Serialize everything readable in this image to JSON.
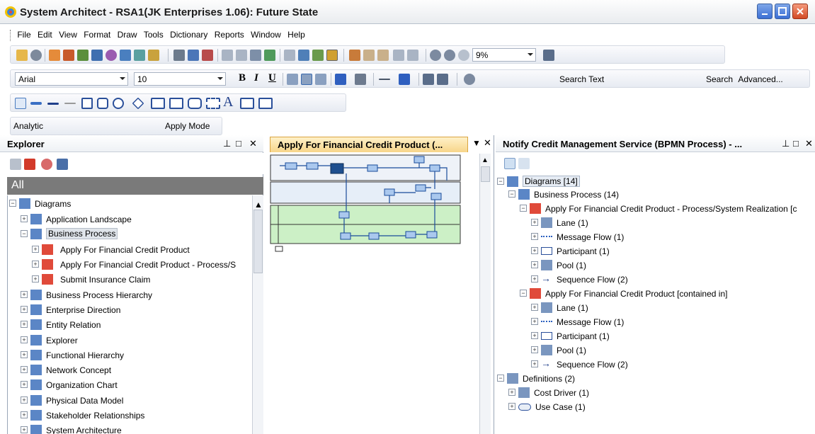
{
  "window": {
    "title": "System Architect - RSA1(JK Enterprises 1.06): Future State"
  },
  "menu": [
    "File",
    "Edit",
    "View",
    "Format",
    "Draw",
    "Tools",
    "Dictionary",
    "Reports",
    "Window",
    "Help"
  ],
  "toolbar": {
    "zoom": "9%",
    "font": "Arial",
    "font_size": "10",
    "search_text": "Search Text",
    "search_label": "Search",
    "advanced_label": "Advanced...",
    "mode": "Analytic",
    "apply_mode": "Apply Mode"
  },
  "explorer": {
    "title": "Explorer",
    "filter": "All",
    "items": [
      {
        "label": "Diagrams"
      },
      {
        "label": "Application Landscape"
      },
      {
        "label": "Business Process"
      },
      {
        "label": "Apply For Financial Credit Product"
      },
      {
        "label": "Apply For Financial Credit Product - Process/S"
      },
      {
        "label": "Submit Insurance Claim"
      },
      {
        "label": "Business Process Hierarchy"
      },
      {
        "label": "Enterprise Direction"
      },
      {
        "label": "Entity Relation"
      },
      {
        "label": "Explorer"
      },
      {
        "label": "Functional Hierarchy"
      },
      {
        "label": "Network Concept"
      },
      {
        "label": "Organization Chart"
      },
      {
        "label": "Physical Data Model"
      },
      {
        "label": "Stakeholder Relationships"
      },
      {
        "label": "System Architecture"
      }
    ]
  },
  "diagram": {
    "tab_title": "Apply For Financial Credit Product (..."
  },
  "details": {
    "title": "Notify Credit Management Service (BPMN Process) - ...",
    "items": [
      {
        "label": "Diagrams [14]"
      },
      {
        "label": "Business Process (14)"
      },
      {
        "label": "Apply For Financial Credit Product - Process/System Realization [c"
      },
      {
        "label": "Lane (1)"
      },
      {
        "label": "Message Flow (1)"
      },
      {
        "label": "Participant (1)"
      },
      {
        "label": "Pool (1)"
      },
      {
        "label": "Sequence Flow (2)"
      },
      {
        "label": "Apply For Financial Credit Product [contained in]"
      },
      {
        "label": "Lane (1)"
      },
      {
        "label": "Message Flow (1)"
      },
      {
        "label": "Participant (1)"
      },
      {
        "label": "Pool (1)"
      },
      {
        "label": "Sequence Flow (2)"
      },
      {
        "label": "Definitions (2)"
      },
      {
        "label": "Cost Driver (1)"
      },
      {
        "label": "Use Case (1)"
      }
    ]
  }
}
